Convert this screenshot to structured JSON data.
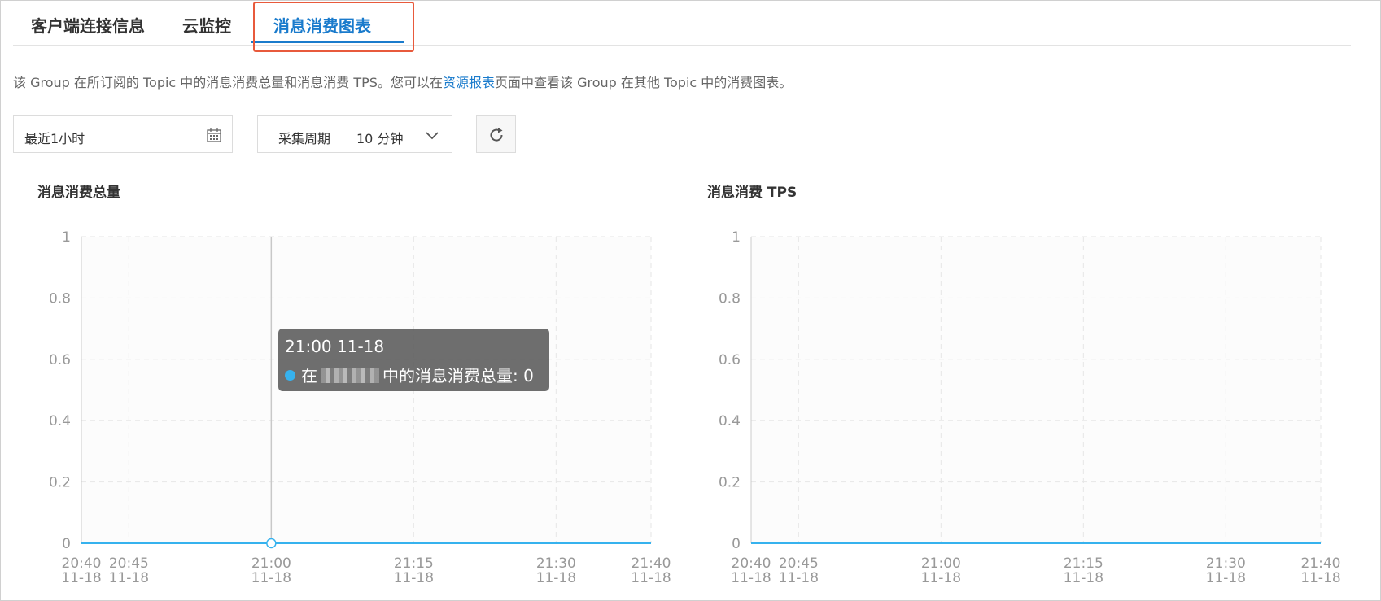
{
  "tabs": [
    {
      "label": "客户端连接信息",
      "active": false
    },
    {
      "label": "云监控",
      "active": false
    },
    {
      "label": "消息消费图表",
      "active": true
    }
  ],
  "description": {
    "before": "该 Group 在所订阅的 Topic 中的消息消费总量和消息消费 TPS。您可以在",
    "link": "资源报表",
    "after": "页面中查看该 Group 在其他 Topic 中的消费图表。"
  },
  "controls": {
    "date_range": "最近1小时",
    "period_label": "采集周期",
    "period_value": "10 分钟",
    "refresh_icon": "refresh-icon",
    "calendar_icon": "calendar-icon",
    "dropdown_icon": "chevron-down-icon"
  },
  "colors": {
    "accent": "#1a7bcc",
    "series": "#36b2ee",
    "highlight_box": "#e85a3c"
  },
  "tooltip": {
    "time": "21:00 11-18",
    "prefix": "在",
    "suffix": "中的消息消费总量: 0"
  },
  "chart_data": [
    {
      "type": "line",
      "title": "消息消费总量",
      "x": [
        "20:40 11-18",
        "20:45 11-18",
        "21:00 11-18",
        "21:15 11-18",
        "21:30 11-18",
        "21:40 11-18"
      ],
      "x_labels": [
        [
          "20:40",
          "11-18"
        ],
        [
          "20:45",
          "11-18"
        ],
        [
          "21:00",
          "11-18"
        ],
        [
          "21:15",
          "11-18"
        ],
        [
          "21:30",
          "11-18"
        ],
        [
          "21:40",
          "11-18"
        ]
      ],
      "x_minutes": [
        0,
        5,
        20,
        35,
        50,
        60
      ],
      "series": [
        {
          "values": [
            0,
            0,
            0,
            0,
            0,
            0
          ]
        }
      ],
      "yticks": [
        0,
        0.2,
        0.4,
        0.6,
        0.8,
        1
      ],
      "ylim": [
        0,
        1
      ],
      "grid": true,
      "hover_x_minutes": 20
    },
    {
      "type": "line",
      "title": "消息消费 TPS",
      "x": [
        "20:40 11-18",
        "20:45 11-18",
        "21:00 11-18",
        "21:15 11-18",
        "21:30 11-18",
        "21:40 11-18"
      ],
      "x_labels": [
        [
          "20:40",
          "11-18"
        ],
        [
          "20:45",
          "11-18"
        ],
        [
          "21:00",
          "11-18"
        ],
        [
          "21:15",
          "11-18"
        ],
        [
          "21:30",
          "11-18"
        ],
        [
          "21:40",
          "11-18"
        ]
      ],
      "x_minutes": [
        0,
        5,
        20,
        35,
        50,
        60
      ],
      "series": [
        {
          "values": [
            0,
            0,
            0,
            0,
            0,
            0
          ]
        }
      ],
      "yticks": [
        0,
        0.2,
        0.4,
        0.6,
        0.8,
        1
      ],
      "ylim": [
        0,
        1
      ],
      "grid": true
    }
  ]
}
